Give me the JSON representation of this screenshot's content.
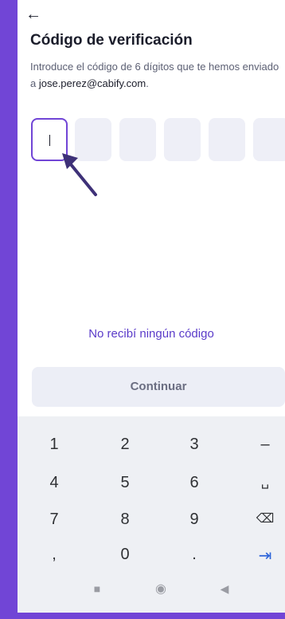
{
  "header": {
    "back_icon": "arrow-left-icon",
    "title": "Código de verificación"
  },
  "description": {
    "text": "Introduce el código de 6 dígitos que te hemos enviado a ",
    "email": "jose.perez@cabify.com",
    "suffix": "."
  },
  "code": {
    "digits": 6,
    "active_index": 0
  },
  "links": {
    "no_code": "No recibí ningún código"
  },
  "buttons": {
    "continue": "Continuar"
  },
  "keyboard": {
    "rows": [
      [
        "1",
        "2",
        "3",
        "–"
      ],
      [
        "4",
        "5",
        "6",
        "␣"
      ],
      [
        "7",
        "8",
        "9",
        "⌫"
      ],
      [
        ",",
        "0",
        ".",
        "⇥"
      ]
    ]
  },
  "colors": {
    "accent": "#7145d6",
    "text": "#1b1d2b",
    "button_bg": "#eceef6"
  }
}
